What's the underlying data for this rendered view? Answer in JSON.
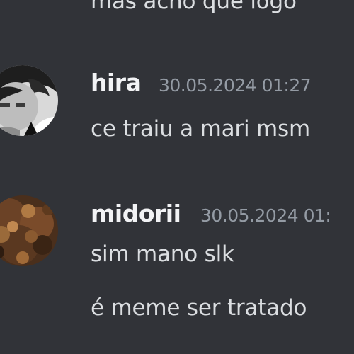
{
  "messages": [
    {
      "continuation_text": "mas acho que logo"
    },
    {
      "username": "hira",
      "timestamp": "30.05.2024 01:27",
      "avatar": "grayscale-anime-avatar",
      "lines": [
        "ce traiu a mari msm"
      ]
    },
    {
      "username": "midorii",
      "timestamp": "30.05.2024 01:",
      "avatar": "brown-textured-avatar",
      "lines": [
        "sim mano slk",
        "é meme ser tratado"
      ]
    }
  ],
  "colors": {
    "background": "#313338",
    "username": "#f2f3f5",
    "message_text": "#dbdee1",
    "timestamp": "#949ba4"
  }
}
